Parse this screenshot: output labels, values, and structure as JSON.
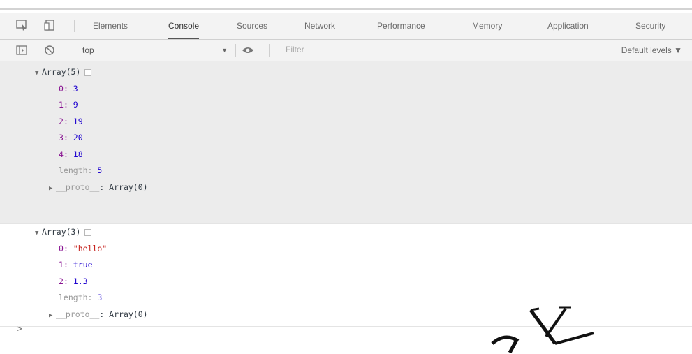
{
  "tabs": [
    "Elements",
    "Console",
    "Sources",
    "Network",
    "Performance",
    "Memory",
    "Application",
    "Security"
  ],
  "active_tab": "Console",
  "toolbar": {
    "context": "top",
    "filter_placeholder": "Filter",
    "levels": "Default levels ▼"
  },
  "messages": [
    {
      "header": "Array(5)",
      "items": [
        {
          "index": "0",
          "value": "3"
        },
        {
          "index": "1",
          "value": "9"
        },
        {
          "index": "2",
          "value": "19"
        },
        {
          "index": "3",
          "value": "20"
        },
        {
          "index": "4",
          "value": "18"
        }
      ],
      "length_label": "length",
      "length": "5",
      "proto_label": "__proto__",
      "proto_value": "Array(0)"
    },
    {
      "header": "Array(3)",
      "items": [
        {
          "index": "0",
          "value": "\"hello\""
        },
        {
          "index": "1",
          "value": "true"
        },
        {
          "index": "2",
          "value": "1.3"
        }
      ],
      "length_label": "length",
      "length": "3",
      "proto_label": "__proto__",
      "proto_value": "Array(0)"
    }
  ],
  "prompt": ">",
  "colors": {
    "index": "#881391",
    "number": "#1c00cf",
    "string": "#c41a16",
    "selected_row": "#ececec"
  }
}
